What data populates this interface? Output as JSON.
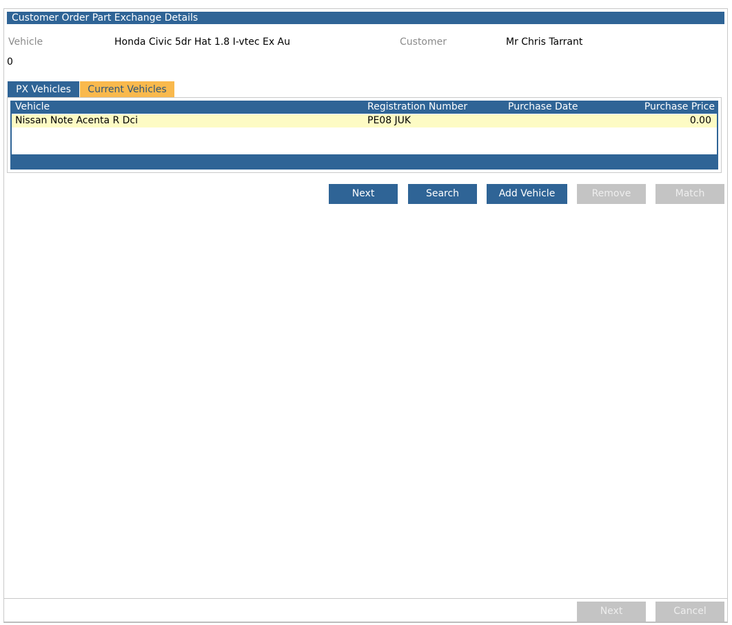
{
  "window": {
    "title": "Customer Order Part Exchange Details"
  },
  "details": {
    "vehicle_label": "Vehicle",
    "vehicle_value": "Honda Civic 5dr Hat 1.8 I-vtec Ex Au",
    "customer_label": "Customer",
    "customer_value": "Mr Chris Tarrant",
    "extra_value": "0"
  },
  "tabs": [
    {
      "label": "PX Vehicles",
      "active": false
    },
    {
      "label": "Current Vehicles",
      "active": true
    }
  ],
  "grid": {
    "columns": [
      "Vehicle",
      "Registration Number",
      "Purchase Date",
      "Purchase Price"
    ],
    "rows": [
      {
        "vehicle": "Nissan Note Acenta R Dci",
        "registration": "PE08 JUK",
        "purchase_date": "",
        "purchase_price": "0.00"
      }
    ]
  },
  "actions": {
    "next": {
      "label": "Next",
      "enabled": true
    },
    "search": {
      "label": "Search",
      "enabled": true
    },
    "add_vehicle": {
      "label": "Add Vehicle",
      "enabled": true
    },
    "remove": {
      "label": "Remove",
      "enabled": false
    },
    "match": {
      "label": "Match",
      "enabled": false
    }
  },
  "footer": {
    "next": {
      "label": "Next",
      "enabled": false
    },
    "cancel": {
      "label": "Cancel",
      "enabled": false
    }
  },
  "colors": {
    "accent": "#2f6496",
    "active_tab": "#f9b94d",
    "selected_row": "#fdfbc4",
    "disabled": "#c4c4c4"
  }
}
